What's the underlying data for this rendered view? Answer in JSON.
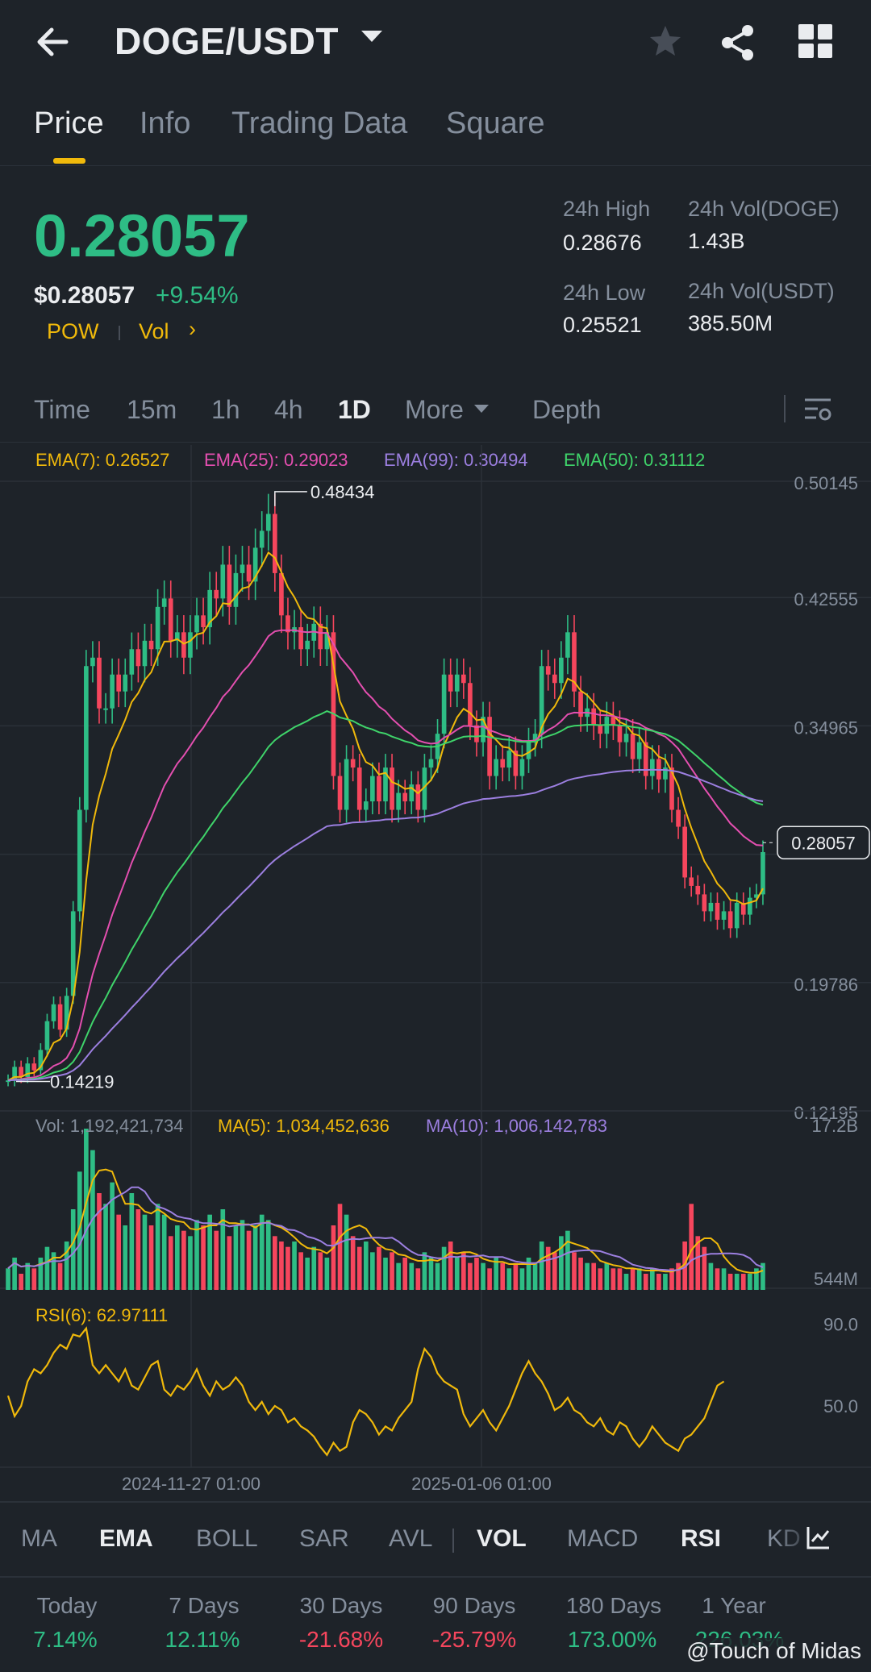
{
  "header": {
    "title": "DOGE/USDT",
    "icons": [
      "back-arrow-icon",
      "caret-down-icon",
      "star-icon",
      "share-icon",
      "grid-icon"
    ]
  },
  "tabs": [
    {
      "label": "Price",
      "active": true
    },
    {
      "label": "Info",
      "active": false
    },
    {
      "label": "Trading Data",
      "active": false
    },
    {
      "label": "Square",
      "active": false
    }
  ],
  "ticker": {
    "last_price": "0.28057",
    "usd_price": "$0.28057",
    "change": "+9.54%",
    "tag_pow": "POW",
    "tag_vol": "Vol",
    "tag_arrow": "›",
    "high_label": "24h High",
    "high_value": "0.28676",
    "low_label": "24h Low",
    "low_value": "0.25521",
    "vol_base_label": "24h Vol(DOGE)",
    "vol_base_value": "1.43B",
    "vol_quote_label": "24h Vol(USDT)",
    "vol_quote_value": "385.50M"
  },
  "intervals": {
    "items": [
      "Time",
      "15m",
      "1h",
      "4h",
      "1D",
      "More",
      "Depth"
    ],
    "active": "1D"
  },
  "ema_legend": [
    {
      "label": "EMA(7): 0.26527",
      "color": "#f0b90b"
    },
    {
      "label": "EMA(25): 0.29023",
      "color": "#e44fb0"
    },
    {
      "label": "EMA(99): 0.30494",
      "color": "#9c7fe0"
    },
    {
      "label": "EMA(50): 0.31112",
      "color": "#3fd46a"
    }
  ],
  "vol_legend": [
    {
      "label": "Vol: 1,192,421,734",
      "color": "#848e9c"
    },
    {
      "label": "MA(5): 1,034,452,636",
      "color": "#f0b90b"
    },
    {
      "label": "MA(10): 1,006,142,783",
      "color": "#9c7fe0"
    }
  ],
  "rsi_legend": {
    "label": "RSI(6): 62.97111",
    "color": "#f0b90b"
  },
  "colors": {
    "up": "#2ebd85",
    "down": "#f6465d",
    "accent": "#f0b90b",
    "ema7": "#f0b90b",
    "ema25": "#e44fb0",
    "ema50": "#3fd46a",
    "ema99": "#9c7fe0"
  },
  "chart_data": {
    "type": "candlestick",
    "price_axis_ticks": [
      "0.50145",
      "0.42555",
      "0.34965",
      "0.28057",
      "0.19786",
      "0.12195"
    ],
    "price_range": [
      0.12195,
      0.50145
    ],
    "last_price_label": "0.28057",
    "max_marker": "0.48434",
    "min_marker": "0.14219",
    "x_ticks": [
      "2024-11-27 01:00",
      "2025-01-06 01:00"
    ],
    "volume_axis_ticks": [
      "17.2B",
      "544M"
    ],
    "rsi_axis_ticks": [
      "90.0",
      "50.0"
    ],
    "close_series": [
      0.14,
      0.148,
      0.142,
      0.15,
      0.146,
      0.158,
      0.175,
      0.185,
      0.17,
      0.19,
      0.24,
      0.3,
      0.385,
      0.39,
      0.36,
      0.36,
      0.38,
      0.37,
      0.38,
      0.395,
      0.385,
      0.4,
      0.395,
      0.42,
      0.425,
      0.4,
      0.405,
      0.39,
      0.405,
      0.415,
      0.408,
      0.43,
      0.425,
      0.445,
      0.42,
      0.44,
      0.445,
      0.435,
      0.455,
      0.465,
      0.475,
      0.44,
      0.415,
      0.405,
      0.408,
      0.395,
      0.4,
      0.41,
      0.395,
      0.405,
      0.32,
      0.3,
      0.33,
      0.325,
      0.3,
      0.305,
      0.32,
      0.305,
      0.325,
      0.3,
      0.31,
      0.305,
      0.315,
      0.3,
      0.325,
      0.33,
      0.345,
      0.38,
      0.37,
      0.38,
      0.375,
      0.35,
      0.34,
      0.355,
      0.32,
      0.33,
      0.325,
      0.335,
      0.32,
      0.33,
      0.34,
      0.345,
      0.385,
      0.38,
      0.375,
      0.39,
      0.405,
      0.37,
      0.355,
      0.36,
      0.35,
      0.345,
      0.355,
      0.35,
      0.34,
      0.345,
      0.33,
      0.34,
      0.32,
      0.33,
      0.318,
      0.325,
      0.3,
      0.29,
      0.26,
      0.255,
      0.25,
      0.24,
      0.245,
      0.235,
      0.24,
      0.23,
      0.245,
      0.238,
      0.248,
      0.25,
      0.275
    ],
    "volume_series": [
      4,
      6,
      3,
      5,
      4,
      6,
      8,
      7,
      5,
      9,
      15,
      22,
      30,
      26,
      18,
      16,
      20,
      14,
      12,
      18,
      15,
      14,
      12,
      16,
      14,
      10,
      12,
      11,
      10,
      13,
      12,
      14,
      11,
      15,
      10,
      12,
      13,
      11,
      12,
      14,
      13,
      10,
      9,
      8,
      9,
      7,
      6,
      8,
      7,
      6,
      12,
      16,
      14,
      10,
      8,
      9,
      7,
      8,
      6,
      7,
      5,
      6,
      5,
      4,
      7,
      6,
      5,
      8,
      9,
      6,
      7,
      5,
      6,
      5,
      4,
      6,
      5,
      4,
      5,
      4,
      6,
      5,
      9,
      8,
      7,
      10,
      11,
      7,
      6,
      5,
      5,
      4,
      5,
      4,
      4,
      3,
      4,
      4,
      3,
      4,
      3,
      3,
      4,
      5,
      9,
      16,
      10,
      8,
      5,
      4,
      4,
      3,
      3,
      3,
      3,
      4,
      5
    ],
    "rsi_series": [
      55,
      45,
      50,
      62,
      68,
      66,
      70,
      76,
      80,
      78,
      85,
      84,
      88,
      70,
      66,
      70,
      66,
      62,
      68,
      60,
      58,
      64,
      70,
      72,
      58,
      55,
      60,
      58,
      62,
      68,
      60,
      55,
      62,
      58,
      60,
      64,
      60,
      52,
      48,
      52,
      46,
      50,
      48,
      42,
      44,
      40,
      38,
      35,
      30,
      26,
      32,
      28,
      30,
      42,
      48,
      46,
      42,
      36,
      40,
      38,
      44,
      48,
      52,
      68,
      78,
      74,
      66,
      62,
      60,
      58,
      46,
      40,
      44,
      48,
      42,
      38,
      44,
      50,
      58,
      66,
      72,
      66,
      62,
      56,
      48,
      50,
      54,
      48,
      46,
      42,
      40,
      44,
      38,
      36,
      42,
      40,
      34,
      30,
      34,
      40,
      36,
      32,
      30,
      28,
      34,
      36,
      40,
      44,
      52,
      60,
      62
    ]
  },
  "indicator_tabs": {
    "items": [
      "MA",
      "EMA",
      "BOLL",
      "SAR",
      "AVL",
      "VOL",
      "MACD",
      "RSI",
      "KD"
    ],
    "active": [
      "EMA",
      "VOL",
      "RSI"
    ]
  },
  "performance": [
    {
      "label": "Today",
      "value": "7.14%",
      "dir": "up"
    },
    {
      "label": "7 Days",
      "value": "12.11%",
      "dir": "up"
    },
    {
      "label": "30 Days",
      "value": "-21.68%",
      "dir": "down"
    },
    {
      "label": "90 Days",
      "value": "-25.79%",
      "dir": "down"
    },
    {
      "label": "180 Days",
      "value": "173.00%",
      "dir": "up"
    },
    {
      "label": "1 Year",
      "value": "226.03%",
      "dir": "up"
    }
  ],
  "watermark": "@Touch of Midas"
}
